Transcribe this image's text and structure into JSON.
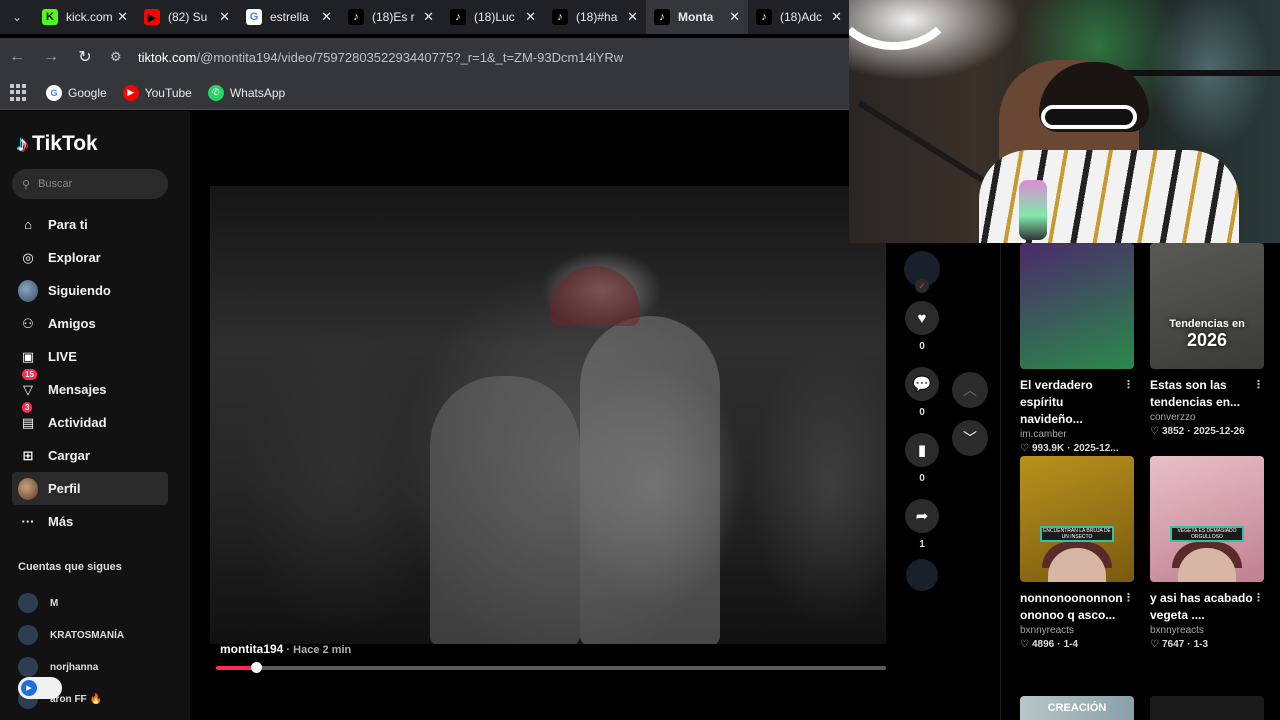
{
  "browser": {
    "tabs": [
      {
        "label": "kick.com",
        "icon": "kick-icon",
        "color": "#53fc18",
        "glyph": "K"
      },
      {
        "label": "(82) Su",
        "icon": "youtube-icon",
        "color": "#ff0000",
        "glyph": "▶"
      },
      {
        "label": "estrella",
        "icon": "google-icon",
        "color": "#ffffff",
        "glyph": "G"
      },
      {
        "label": "(18)Es r",
        "icon": "tiktok-icon",
        "color": "#000000",
        "glyph": "♪"
      },
      {
        "label": "(18)Luc",
        "icon": "tiktok-icon",
        "color": "#000000",
        "glyph": "♪"
      },
      {
        "label": "(18)#ha",
        "icon": "tiktok-icon",
        "color": "#000000",
        "glyph": "♪"
      },
      {
        "label": "Monta",
        "icon": "tiktok-icon",
        "color": "#000000",
        "glyph": "♪",
        "active": true
      },
      {
        "label": "(18)Adc",
        "icon": "tiktok-icon",
        "color": "#000000",
        "glyph": "♪"
      }
    ],
    "url_host": "tiktok.com",
    "url_path": "/@montita194/video/7597280352293440775?_r=1&_t=ZM-93Dcm14iYRw",
    "bookmarks": [
      {
        "label": "Google",
        "icon": "google-icon",
        "color": "#ffffff",
        "glyph": "G"
      },
      {
        "label": "YouTube",
        "icon": "youtube-icon",
        "color": "#ff0000",
        "glyph": "▶"
      },
      {
        "label": "WhatsApp",
        "icon": "whatsapp-icon",
        "color": "#25d366",
        "glyph": "✆"
      }
    ]
  },
  "tiktok": {
    "brand": "TikTok",
    "search_placeholder": "Buscar",
    "nav": [
      {
        "label": "Para ti",
        "icon": "home-icon",
        "glyph": "⌂"
      },
      {
        "label": "Explorar",
        "icon": "compass-icon",
        "glyph": "◎"
      },
      {
        "label": "Siguiendo",
        "icon": "following-avatar-icon",
        "glyph": ""
      },
      {
        "label": "Amigos",
        "icon": "friends-icon",
        "glyph": "⚇"
      },
      {
        "label": "LIVE",
        "icon": "live-icon",
        "glyph": "▣"
      },
      {
        "label": "Mensajes",
        "icon": "messages-icon",
        "glyph": "▽",
        "badge": "15"
      },
      {
        "label": "Actividad",
        "icon": "activity-icon",
        "glyph": "▤",
        "badge": "3"
      },
      {
        "label": "Cargar",
        "icon": "upload-icon",
        "glyph": "⊞"
      },
      {
        "label": "Perfil",
        "icon": "profile-avatar-icon",
        "glyph": "",
        "active": true
      },
      {
        "label": "Más",
        "icon": "more-icon",
        "glyph": "···"
      }
    ],
    "following_title": "Cuentas que sigues",
    "following": [
      {
        "name": "M"
      },
      {
        "name": "KRATOSMANÍA"
      },
      {
        "name": "norjhanna"
      },
      {
        "name": "aron FF 🔥"
      }
    ]
  },
  "video": {
    "username": "montita194",
    "time": " · Hace 2 min",
    "progress": 0.06,
    "actions": [
      {
        "name": "like",
        "icon": "heart-icon",
        "glyph": "♥",
        "count": "0"
      },
      {
        "name": "comment",
        "icon": "comment-icon",
        "glyph": "💬",
        "count": "0"
      },
      {
        "name": "save",
        "icon": "bookmark-icon",
        "glyph": "▮",
        "count": "0"
      },
      {
        "name": "share",
        "icon": "share-icon",
        "glyph": "➦",
        "count": "1"
      }
    ]
  },
  "related": [
    {
      "title": "El verdadero espíritu navideño...",
      "author": "im.camber",
      "likes": "993.9K",
      "date": "2025-12...",
      "palette": [
        "#4b2a6a",
        "#2a8a4a"
      ],
      "overlay": "",
      "overlay_small": ""
    },
    {
      "title": "Estas son las tendencias en...",
      "author": "converzzo",
      "likes": "3852",
      "date": "2025-12-26",
      "palette": [
        "#5a5a55",
        "#3a3a38"
      ],
      "overlay": "2026",
      "overlay_small": "Tendencias en"
    },
    {
      "title": "nonnonoononnon ononoo q asco...",
      "author": "bxnnyreacts",
      "likes": "4896",
      "date": "1-4",
      "palette": [
        "#b8921c",
        "#7a5a10"
      ],
      "overlay": "",
      "overlay_small": "",
      "tag": "ENCUENTRAN LA BRUJA DE UN INSECTO"
    },
    {
      "title": "y asi has acabado vegeta ....",
      "author": "bxnnyreacts",
      "likes": "7647",
      "date": "1-3",
      "palette": [
        "#e8c0c8",
        "#c08090"
      ],
      "overlay": "",
      "overlay_small": "",
      "tag": "VEGETA ES DEMASIADO ORGULLOSO"
    }
  ],
  "colors": {
    "accent": "#fe2c55",
    "chrome_bg": "#35363a",
    "tabbar_bg": "#202124",
    "sidebar_bg": "#121212"
  }
}
